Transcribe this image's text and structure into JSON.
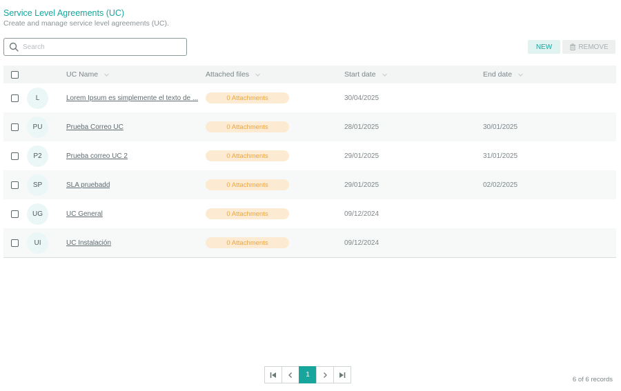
{
  "header": {
    "title": "Service Level Agreements (UC)",
    "subtitle": "Create and manage service level agreements (UC)."
  },
  "search": {
    "placeholder": "Search",
    "value": ""
  },
  "toolbar": {
    "new_label": "NEW",
    "remove_label": "REMOVE"
  },
  "table": {
    "columns": {
      "name": "UC Name",
      "files": "Attached files",
      "start": "Start date",
      "end": "End date"
    },
    "rows": [
      {
        "initials": "L",
        "name": "Lorem Ipsum es simplemente el texto de ...",
        "attachments": "0 Attachments",
        "start": "30/04/2025",
        "end": ""
      },
      {
        "initials": "PU",
        "name": "Prueba Correo UC",
        "attachments": "0 Attachments",
        "start": "28/01/2025",
        "end": "30/01/2025"
      },
      {
        "initials": "P2",
        "name": "Prueba correo UC 2",
        "attachments": "0 Attachments",
        "start": "29/01/2025",
        "end": "31/01/2025"
      },
      {
        "initials": "SP",
        "name": "SLA pruebadd",
        "attachments": "0 Attachments",
        "start": "29/01/2025",
        "end": "02/02/2025"
      },
      {
        "initials": "UG",
        "name": "UC General",
        "attachments": "0 Attachments",
        "start": "09/12/2024",
        "end": ""
      },
      {
        "initials": "UI",
        "name": "UC Instalación",
        "attachments": "0 Attachments",
        "start": "09/12/2024",
        "end": ""
      }
    ]
  },
  "pagination": {
    "current_page": "1",
    "records_text": "6 of 6 records"
  },
  "colors": {
    "accent": "#17a59c",
    "pill_bg": "#fcebd2",
    "pill_text": "#eea53b"
  }
}
